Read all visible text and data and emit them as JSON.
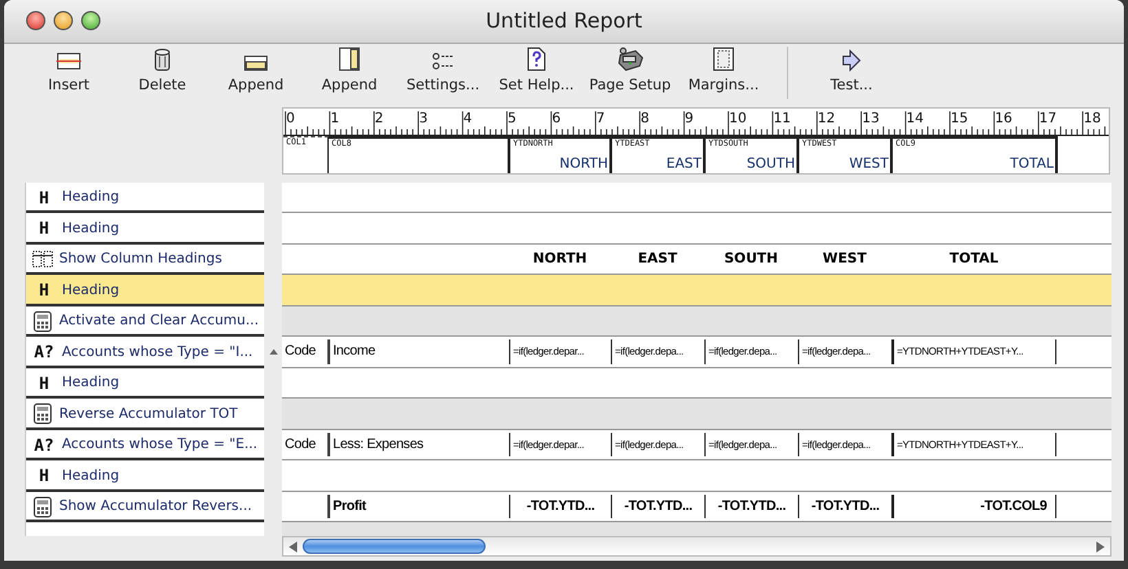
{
  "window": {
    "title": "Untitled Report"
  },
  "toolbar": [
    {
      "kind": "insert",
      "label": "Insert"
    },
    {
      "kind": "delete",
      "label": "Delete"
    },
    {
      "kind": "append-row",
      "label": "Append"
    },
    {
      "kind": "append-column",
      "label": "Append"
    },
    {
      "kind": "settings",
      "label": "Settings..."
    },
    {
      "kind": "help",
      "label": "Set Help..."
    },
    {
      "kind": "page-setup",
      "label": "Page Setup"
    },
    {
      "kind": "margins",
      "label": "Margins..."
    },
    {
      "kind": "test",
      "label": "Test..."
    }
  ],
  "ruler": [
    "0",
    "1",
    "2",
    "3",
    "4",
    "5",
    "6",
    "7",
    "8",
    "9",
    "10",
    "11",
    "12",
    "13",
    "14",
    "15",
    "16",
    "17",
    "18"
  ],
  "columns": [
    {
      "name": "COL1"
    },
    {
      "name": "COL8"
    },
    {
      "name": "YTDNORTH",
      "label": "NORTH"
    },
    {
      "name": "YTDEAST",
      "label": "EAST"
    },
    {
      "name": "YTDSOUTH",
      "label": "SOUTH"
    },
    {
      "name": "YTDWEST",
      "label": "WEST"
    },
    {
      "name": "COL9",
      "label": "TOTAL"
    }
  ],
  "rows": [
    {
      "kind": "heading",
      "glyph": "H",
      "label": "Heading",
      "selected": false,
      "caret": false,
      "band": {
        "kind": "blank"
      }
    },
    {
      "kind": "heading",
      "glyph": "H",
      "label": "Heading",
      "selected": false,
      "caret": false,
      "band": {
        "kind": "blank"
      }
    },
    {
      "kind": "columns",
      "label": "Show Column Headings",
      "selected": false,
      "caret": false,
      "band": {
        "kind": "headings",
        "labels": [
          "NORTH",
          "EAST",
          "SOUTH",
          "WEST",
          "TOTAL"
        ]
      }
    },
    {
      "kind": "heading",
      "glyph": "H",
      "label": "Heading",
      "selected": true,
      "caret": false,
      "band": {
        "kind": "blank"
      }
    },
    {
      "kind": "calc",
      "label": "Activate and Clear Accumu...",
      "selected": false,
      "caret": false,
      "band": {
        "kind": "shaded"
      }
    },
    {
      "kind": "query",
      "glyph": "A?",
      "label": "Accounts whose Type = \"I...",
      "selected": false,
      "caret": true,
      "band": {
        "kind": "cells",
        "code": "Code",
        "cells": [
          "Income",
          "=if(ledger.depar...",
          "=if(ledger.depa...",
          "=if(ledger.depa...",
          "=if(ledger.depa...",
          "=YTDNORTH+YTDEAST+Y..."
        ]
      }
    },
    {
      "kind": "heading",
      "glyph": "H",
      "label": "Heading",
      "selected": false,
      "caret": false,
      "band": {
        "kind": "blank"
      }
    },
    {
      "kind": "calc",
      "label": "Reverse Accumulator TOT",
      "selected": false,
      "caret": false,
      "band": {
        "kind": "shaded"
      }
    },
    {
      "kind": "query",
      "glyph": "A?",
      "label": "Accounts whose Type = \"E...",
      "selected": false,
      "caret": false,
      "band": {
        "kind": "cells",
        "code": "Code",
        "cells": [
          "Less: Expenses",
          "=if(ledger.depar...",
          "=if(ledger.depa...",
          "=if(ledger.depa...",
          "=if(ledger.depa...",
          "=YTDNORTH+YTDEAST+Y..."
        ]
      }
    },
    {
      "kind": "heading",
      "glyph": "H",
      "label": "Heading",
      "selected": false,
      "caret": false,
      "band": {
        "kind": "blank"
      }
    },
    {
      "kind": "calc",
      "label": "Show Accumulator Revers...",
      "selected": false,
      "caret": false,
      "band": {
        "kind": "totals",
        "cells": [
          "Profit",
          "-TOT.YTD...",
          "-TOT.YTD...",
          "-TOT.YTD...",
          "-TOT.YTD...",
          "-TOT.COL9"
        ]
      }
    }
  ]
}
